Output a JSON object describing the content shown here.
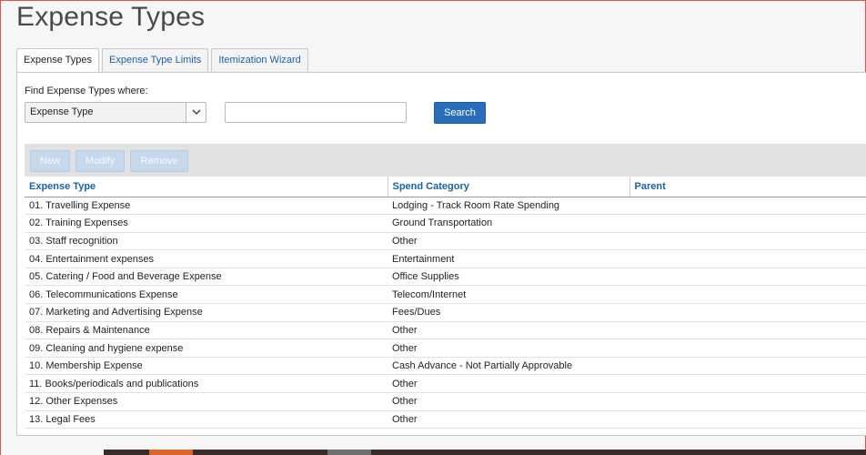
{
  "page": {
    "title": "Expense Types"
  },
  "tabs": [
    {
      "label": "Expense Types",
      "active": true
    },
    {
      "label": "Expense Type Limits",
      "active": false
    },
    {
      "label": "Itemization Wizard",
      "active": false
    }
  ],
  "search": {
    "label": "Find Expense Types where:",
    "field_value": "Expense Type",
    "input_value": "",
    "button_label": "Search"
  },
  "toolbar": {
    "new_label": "New",
    "modify_label": "Modify",
    "remove_label": "Remove"
  },
  "table": {
    "headers": [
      "Expense Type",
      "Spend Category",
      "Parent"
    ],
    "rows": [
      [
        "01. Travelling Expense",
        "Lodging - Track Room Rate Spending",
        ""
      ],
      [
        "02. Training Expenses",
        "Ground Transportation",
        ""
      ],
      [
        "03. Staff recognition",
        "Other",
        ""
      ],
      [
        "04. Entertainment expenses",
        "Entertainment",
        ""
      ],
      [
        "05. Catering / Food and Beverage Expense",
        "Office Supplies",
        ""
      ],
      [
        "06. Telecommunications Expense",
        "Telecom/Internet",
        ""
      ],
      [
        "07. Marketing and Advertising Expense",
        "Fees/Dues",
        ""
      ],
      [
        "08. Repairs & Maintenance",
        "Other",
        ""
      ],
      [
        "09. Cleaning and hygiene expense",
        "Other",
        ""
      ],
      [
        "10. Membership Expense",
        "Cash Advance - Not Partially Approvable",
        ""
      ],
      [
        "11. Books/periodicals and publications",
        "Other",
        ""
      ],
      [
        "12. Other Expenses",
        "Other",
        ""
      ],
      [
        "13. Legal Fees",
        "Other",
        ""
      ]
    ]
  },
  "colors": {
    "accent": "#1b62a6",
    "primary_button": "#2a6ebb",
    "disabled_button": "#c6d9ec"
  }
}
